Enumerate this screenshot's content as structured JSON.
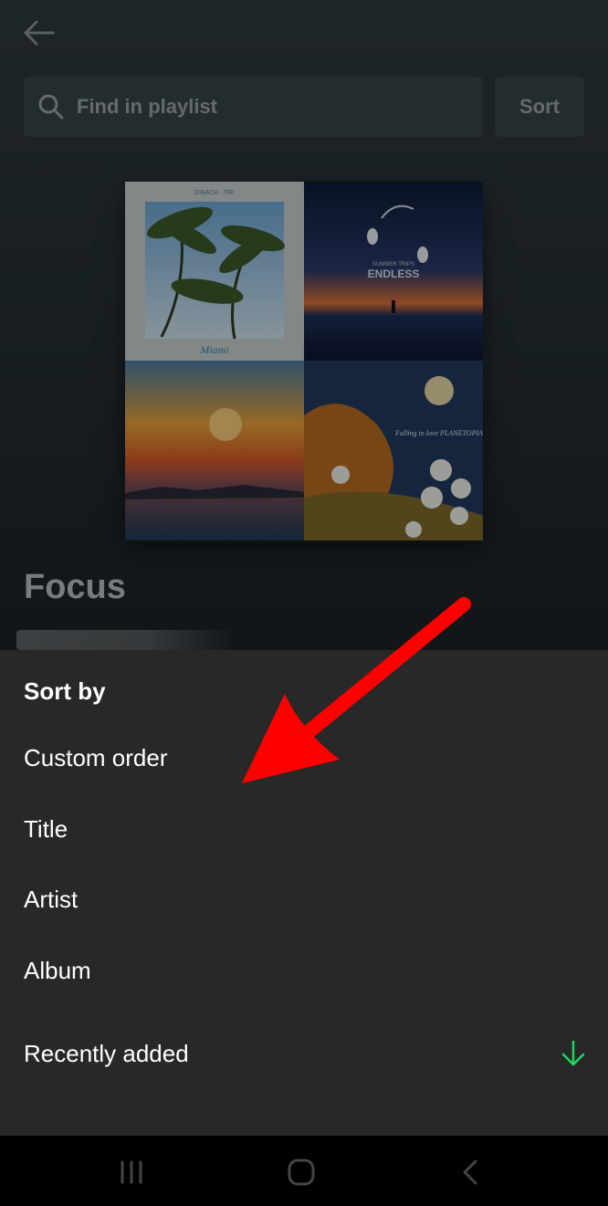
{
  "header": {
    "back_icon": "arrow-left-icon"
  },
  "search": {
    "placeholder": "Find in playlist",
    "icon": "search-icon"
  },
  "sort_button": {
    "label": "Sort"
  },
  "playlist": {
    "title": "Focus"
  },
  "cover_tiles": [
    {
      "top_text": "D'BACH · TRI",
      "bottom_text": "Miami"
    },
    {
      "title_small": "SUMMER TRIPS",
      "title": "ENDLESS"
    },
    {},
    {
      "text": "Falling in love PLANETOPIA"
    }
  ],
  "sheet": {
    "heading": "Sort by",
    "options": [
      {
        "label": "Custom order"
      },
      {
        "label": "Title"
      },
      {
        "label": "Artist"
      },
      {
        "label": "Album"
      },
      {
        "label": "Recently added",
        "selected": true,
        "indicator_icon": "arrow-down-icon"
      }
    ]
  },
  "colors": {
    "sheet_bg": "#282828",
    "accent_green": "#1ed760",
    "annotation_red": "#ff0000"
  },
  "navbar": {
    "items": [
      "recent-apps-icon",
      "home-icon",
      "back-icon"
    ]
  }
}
